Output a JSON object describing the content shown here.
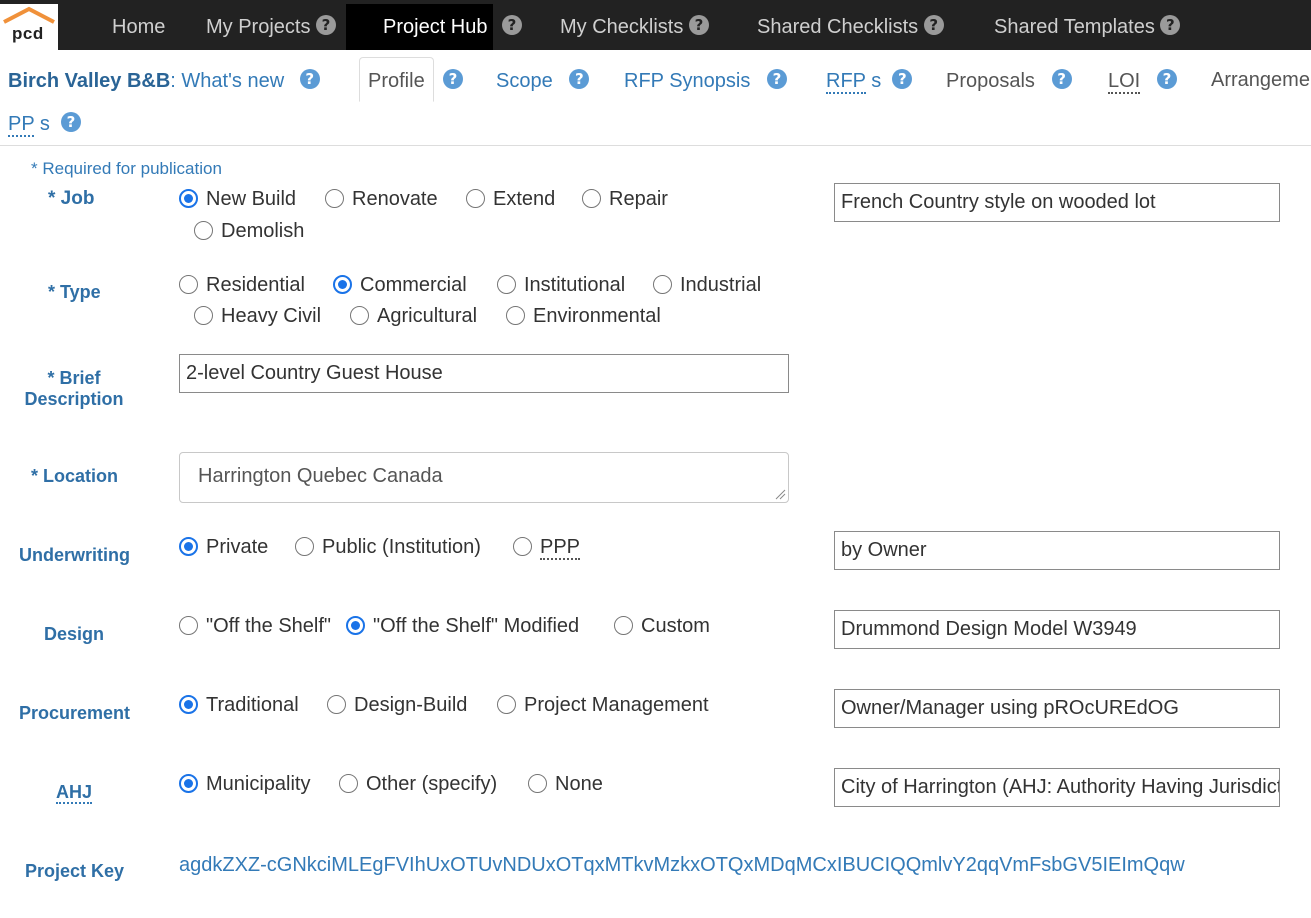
{
  "app": {
    "logo_text": "pcd"
  },
  "nav": {
    "home": "Home",
    "my_projects": "My Projects",
    "project_hub": "Project Hub",
    "my_checklists": "My Checklists",
    "shared_checklists": "Shared Checklists",
    "shared_templates": "Shared Templates",
    "help_glyph": "?"
  },
  "project": {
    "name": "Birch Valley B&B",
    "separator": ":",
    "whats_new": "What's new"
  },
  "tabs": {
    "profile": "Profile",
    "scope": "Scope",
    "rfp_synopsis": "RFP Synopsis",
    "rfps_abbr": "RFP",
    "rfps_suffix": " s",
    "proposals": "Proposals",
    "loi": "LOI",
    "arrangements": "Arrangeme",
    "pps_abbr": "PP",
    "pps_suffix": " s"
  },
  "form": {
    "required_note": "* Required for publication",
    "job": {
      "label": "* Job",
      "options": [
        "New Build",
        "Renovate",
        "Extend",
        "Repair",
        "Demolish"
      ],
      "selected": "New Build",
      "note": "French Country style on wooded lot"
    },
    "type": {
      "label": "* Type",
      "options": [
        "Residential",
        "Commercial",
        "Institutional",
        "Industrial",
        "Heavy Civil",
        "Agricultural",
        "Environmental"
      ],
      "selected": "Commercial"
    },
    "brief": {
      "label_line1": "* Brief",
      "label_line2": "Description",
      "value": "2-level Country Guest House"
    },
    "location": {
      "label": "* Location",
      "value": "Harrington  Quebec  Canada"
    },
    "underwriting": {
      "label": "Underwriting",
      "options": [
        "Private",
        "Public (Institution)",
        "PPP"
      ],
      "selected": "Private",
      "note": "by  Owner"
    },
    "design": {
      "label": "Design",
      "options": [
        "\"Off the Shelf\"",
        "\"Off the Shelf\" Modified",
        "Custom"
      ],
      "selected": "\"Off the Shelf\" Modified",
      "note": "Drummond Design Model W3949"
    },
    "procurement": {
      "label": "Procurement",
      "options": [
        "Traditional",
        "Design-Build",
        "Project Management"
      ],
      "selected": "Traditional",
      "note": "Owner/Manager using pROcUREdOG"
    },
    "ahj": {
      "label": "AHJ",
      "options": [
        "Municipality",
        "Other (specify)",
        "None"
      ],
      "selected": "Municipality",
      "note": "City of Harrington (AHJ: Authority Having Jurisdiction)"
    },
    "project_key": {
      "label": "Project Key",
      "value": "agdkZXZ-cGNkciMLEgFVIhUxOTUvNDUxOTqxMTkvMzkxOTQxMDqMCxIBUCIQQmlvY2qqVmFsbGV5IEImQqw"
    }
  },
  "colors": {
    "accent": "#337ab7",
    "nav_bg": "#222222",
    "radio_selected": "#1a73e8",
    "logo_roof": "#f0913a"
  }
}
